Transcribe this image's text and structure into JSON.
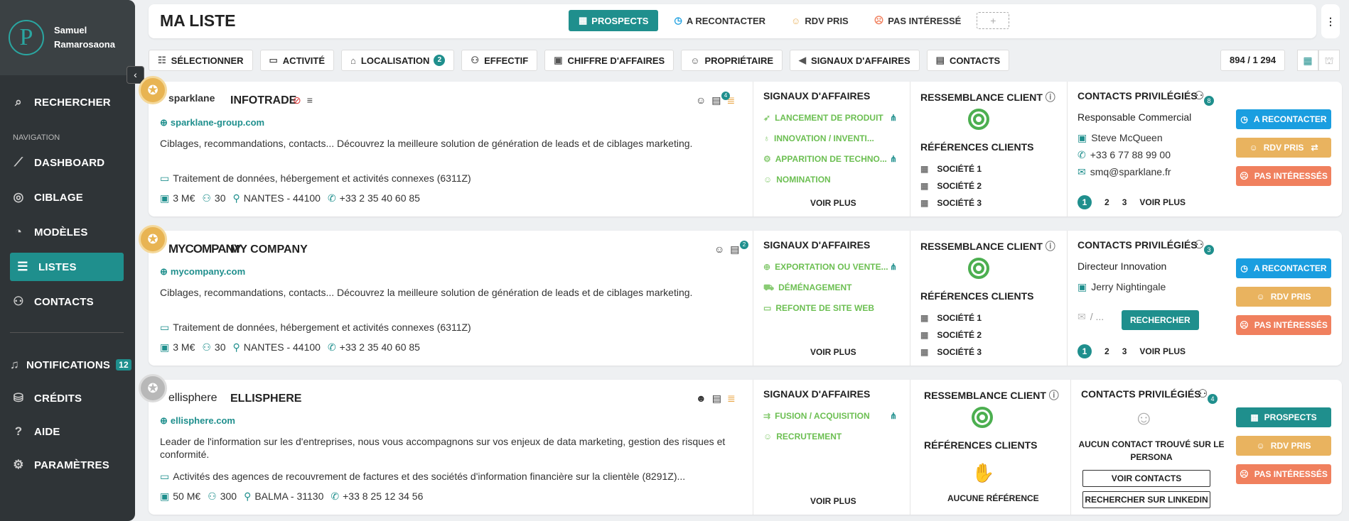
{
  "user": {
    "first": "Samuel",
    "last": "Ramarosaona",
    "logo_letter": "P"
  },
  "sidebar": {
    "search": "RECHERCHER",
    "nav_heading": "NAVIGATION",
    "items": [
      {
        "label": "DASHBOARD",
        "icon": "chart-line-icon"
      },
      {
        "label": "CIBLAGE",
        "icon": "target-icon"
      },
      {
        "label": "MODÈLES",
        "icon": "pie-chart-icon"
      },
      {
        "label": "LISTES",
        "icon": "list-icon",
        "active": true
      },
      {
        "label": "CONTACTS",
        "icon": "users-icon"
      }
    ],
    "bottom": [
      {
        "label": "NOTIFICATIONS",
        "icon": "bell-icon",
        "badge": "12"
      },
      {
        "label": "CRÉDITS",
        "icon": "coins-icon"
      },
      {
        "label": "AIDE",
        "icon": "help-icon"
      },
      {
        "label": "PARAMÈTRES",
        "icon": "settings-icon"
      }
    ]
  },
  "header": {
    "title": "MA LISTE",
    "tabs": [
      {
        "label": "PROSPECTS",
        "active": true
      },
      {
        "label": "A RECONTACTER"
      },
      {
        "label": "RDV PRIS"
      },
      {
        "label": "PAS INTÉRESSÉ"
      }
    ],
    "add_tab": "+"
  },
  "filters": [
    {
      "label": "SÉLECTIONNER"
    },
    {
      "label": "ACTIVITÉ"
    },
    {
      "label": "LOCALISATION",
      "badge": "2"
    },
    {
      "label": "EFFECTIF"
    },
    {
      "label": "CHIFFRE D'AFFAIRES"
    },
    {
      "label": "PROPRIÉTAIRE"
    },
    {
      "label": "SIGNAUX D'AFFAIRES"
    },
    {
      "label": "CONTACTS"
    }
  ],
  "result_count": "894 / 1 294",
  "labels": {
    "signals": "SIGNAUX D'AFFAIRES",
    "resemblance": "RESSEMBLANCE CLIENT",
    "references": "RÉFÉRENCES CLIENTS",
    "contacts": "CONTACTS PRIVILÉGIÉS",
    "voir_plus": "VOIR PLUS",
    "btn_recontact": "A RECONTACTER",
    "btn_rdv": "RDV PRIS",
    "btn_pas": "PAS INTÉRESSÉS",
    "btn_prospects": "PROSPECTS",
    "search": "RECHERCHER",
    "no_contact": "AUCUN CONTACT TROUVÉ SUR LE PERSONA",
    "voir_contacts": "VOIR CONTACTS",
    "linkedin": "RECHERCHER SUR LINKEDIN",
    "no_ref": "AUCUNE RÉFÉRENCE",
    "pages": [
      "1",
      "2",
      "3"
    ]
  },
  "companies": [
    {
      "brand": "sparklane",
      "name": "INFOTRADE",
      "website": "sparklane-group.com",
      "description": "Ciblages, recommandations, contacts... Découvrez la meilleure solution de génération de leads et de ciblages marketing.",
      "activity": "Traitement de données, hébergement et activités connexes (6311Z)",
      "revenue": "3 M€",
      "staff": "30",
      "location": "NANTES - 44100",
      "phone": "+33 2 35 40 60 85",
      "notes_badge": "4",
      "signals": [
        "LANCEMENT DE PRODUIT",
        "INNOVATION / INVENTI...",
        "APPARITION DE TECHNO...",
        "NOMINATION"
      ],
      "references": [
        "SOCIÉTÉ 1",
        "SOCIÉTÉ 2",
        "SOCIÉTÉ 3"
      ],
      "contact_count": "8",
      "contact_role": "Responsable Commercial",
      "contact_name": "Steve McQueen",
      "contact_phone": "+33 6 77 88 99 00",
      "contact_email": "smq@sparklane.fr"
    },
    {
      "brand": "MYCOMPANY",
      "name": "MY COMPANY",
      "website": "mycompany.com",
      "description": "Ciblages, recommandations, contacts... Découvrez la meilleure solution de génération de leads et de ciblages marketing.",
      "activity": "Traitement de données, hébergement et activités connexes (6311Z)",
      "revenue": "3 M€",
      "staff": "30",
      "location": "NANTES - 44100",
      "phone": "+33 2 35 40 60 85",
      "notes_badge": "2",
      "signals": [
        "EXPORTATION OU VENTE...",
        "DÉMÉNAGEMENT",
        "REFONTE DE SITE WEB"
      ],
      "references": [
        "SOCIÉTÉ 1",
        "SOCIÉTÉ 2",
        "SOCIÉTÉ 3"
      ],
      "contact_count": "3",
      "contact_role": "Directeur Innovation",
      "contact_name": "Jerry Nightingale",
      "contact_masked": "/ ..."
    },
    {
      "brand": "ellisphere",
      "name": "ELLISPHERE",
      "website": "ellisphere.com",
      "description": "Leader de l'information sur les d'entreprises, nous vous accompagnons sur vos enjeux de data marketing, gestion des risques et conformité.",
      "activity": "Activités des agences de recouvrement de factures et des sociétés d'information financière sur la clientèle (8291Z)...",
      "revenue": "50 M€",
      "staff": "300",
      "location": "BALMA - 31130",
      "phone": "+33 8 25 12 34 56",
      "signals": [
        "FUSION / ACQUISITION",
        "RECRUTEMENT"
      ],
      "contact_count": "4"
    }
  ],
  "colors": {
    "teal": "#1f8f8d",
    "blue": "#1a9ee0",
    "orange": "#e9b35f",
    "red": "#f0805e",
    "green": "#6cbf52"
  }
}
